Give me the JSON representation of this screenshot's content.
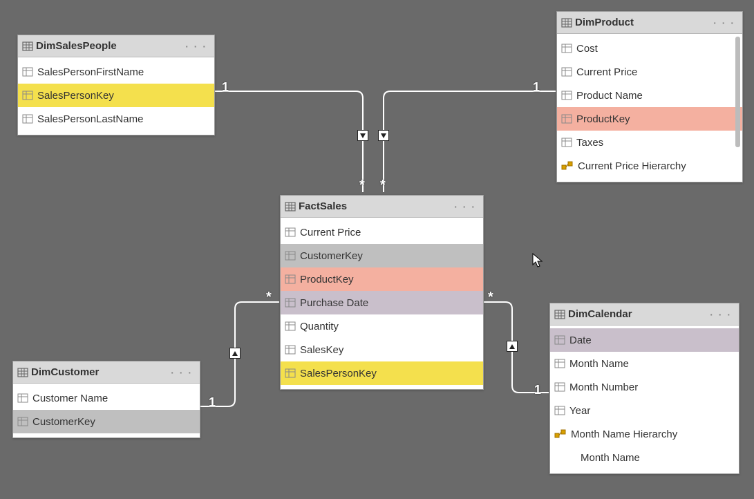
{
  "tables": {
    "dimSalesPeople": {
      "title": "DimSalesPeople",
      "fields": {
        "firstName": "SalesPersonFirstName",
        "key": "SalesPersonKey",
        "lastName": "SalesPersonLastName"
      }
    },
    "dimProduct": {
      "title": "DimProduct",
      "fields": {
        "cost": "Cost",
        "currentPrice": "Current Price",
        "productName": "Product Name",
        "key": "ProductKey",
        "taxes": "Taxes",
        "hierarchy": "Current Price Hierarchy"
      }
    },
    "factSales": {
      "title": "FactSales",
      "fields": {
        "currentPrice": "Current Price",
        "customerKey": "CustomerKey",
        "productKey": "ProductKey",
        "purchaseDate": "Purchase Date",
        "quantity": "Quantity",
        "salesKey": "SalesKey",
        "salesPersonKey": "SalesPersonKey"
      }
    },
    "dimCustomer": {
      "title": "DimCustomer",
      "fields": {
        "customerName": "Customer Name",
        "key": "CustomerKey"
      }
    },
    "dimCalendar": {
      "title": "DimCalendar",
      "fields": {
        "date": "Date",
        "monthName": "Month Name",
        "monthNumber": "Month Number",
        "year": "Year",
        "hierarchy": "Month Name Hierarchy",
        "hierarchyChild": "Month Name"
      }
    }
  },
  "cardinality": {
    "one": "1",
    "many": "*"
  },
  "moreGlyph": "· · ·"
}
